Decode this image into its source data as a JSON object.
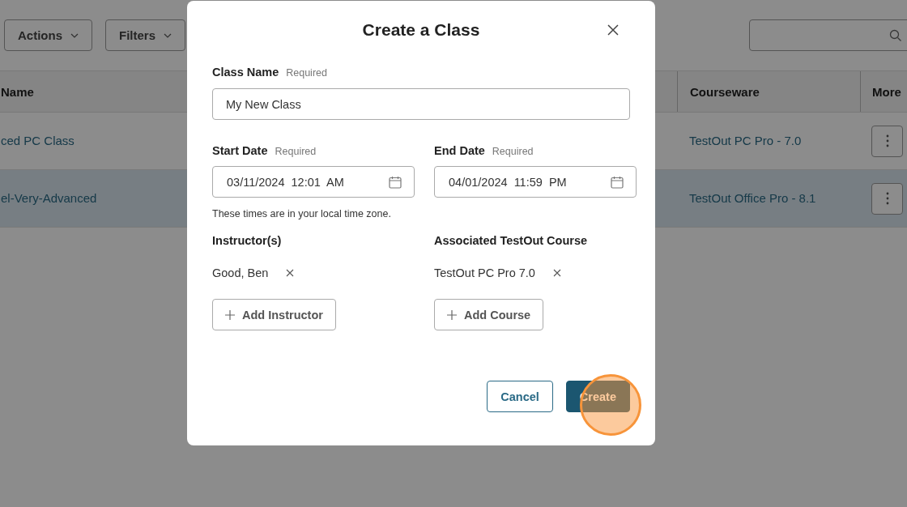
{
  "toolbar": {
    "buttons": [
      {
        "label": "Actions"
      },
      {
        "label": "Filters"
      }
    ]
  },
  "table": {
    "columns": [
      "Name",
      "Courseware",
      "More"
    ],
    "rows": [
      {
        "name": "ced PC Class",
        "courseware": "TestOut PC Pro - 7.0",
        "selected": false
      },
      {
        "name": "el-Very-Advanced",
        "courseware": "TestOut Office Pro - 8.1",
        "selected": true
      }
    ]
  },
  "dialog": {
    "title": "Create a Class",
    "class_name": {
      "label": "Class Name",
      "note": "Required",
      "value": "My New Class"
    },
    "dates": [
      {
        "label": "Start Date",
        "note": "Required",
        "value": "03/11/2024  12:01  AM"
      },
      {
        "label": "End Date",
        "note": "Required",
        "value": "04/01/2024  11:59  PM"
      }
    ],
    "hint": "These times are in your local time zone.",
    "pickers": [
      {
        "label": "Instructor(s)",
        "items": [
          "Good, Ben"
        ],
        "add_button": "Add Instructor"
      },
      {
        "label": "Associated TestOut Course",
        "items": [
          "TestOut PC Pro 7.0"
        ],
        "add_button": "Add Course"
      }
    ],
    "buttons": [
      {
        "kind": "secondary",
        "label": "Cancel"
      },
      {
        "kind": "primary",
        "label": "Create"
      }
    ]
  }
}
